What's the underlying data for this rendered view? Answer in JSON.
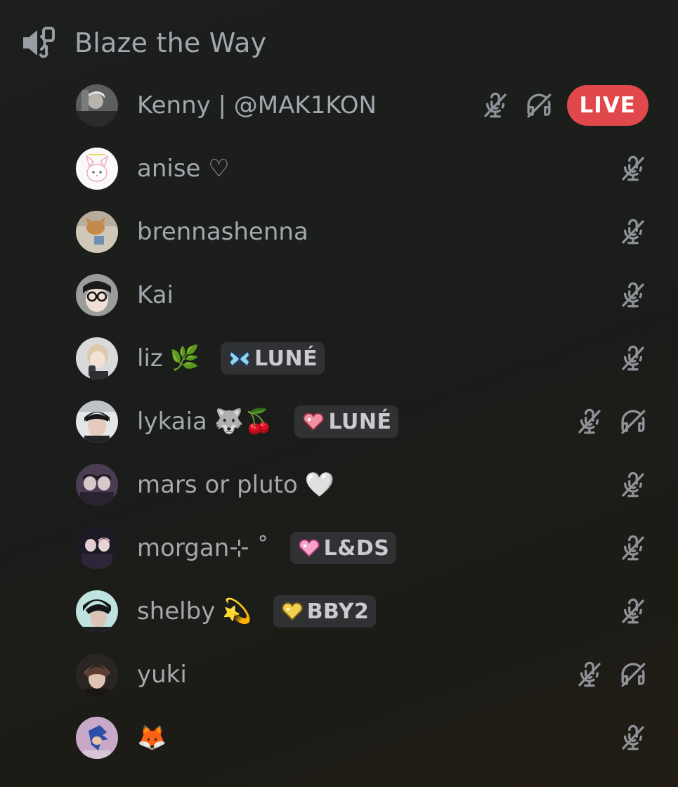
{
  "channel": {
    "name": "Blaze the Way",
    "icon": "voice-channel-speaker-icon"
  },
  "colors": {
    "background": "#1c1e1c",
    "text": "#a4a7ae",
    "icon": "#8f9298",
    "live_badge": "#e0484b",
    "tag_background": "#2f3133"
  },
  "members": [
    {
      "name": "Kenny | @MAK1KON",
      "emoji": "",
      "tag": null,
      "muted": true,
      "deafened": true,
      "live": "LIVE"
    },
    {
      "name": "anise ♡",
      "emoji": "",
      "tag": null,
      "muted": true,
      "deafened": false,
      "live": null
    },
    {
      "name": "brennashenna",
      "emoji": "",
      "tag": null,
      "muted": true,
      "deafened": false,
      "live": null
    },
    {
      "name": "Kai",
      "emoji": "",
      "tag": null,
      "muted": true,
      "deafened": false,
      "live": null
    },
    {
      "name": "liz",
      "emoji": "🌿",
      "tag": {
        "badge": "butterfly-icon",
        "label": "LUNÉ"
      },
      "muted": true,
      "deafened": false,
      "live": null
    },
    {
      "name": "lykaia",
      "emoji": "🐺🍒",
      "tag": {
        "badge": "heart-icon",
        "label": "LUNÉ"
      },
      "muted": true,
      "deafened": true,
      "live": null
    },
    {
      "name": "mars or pluto",
      "emoji": "🤍",
      "tag": null,
      "muted": true,
      "deafened": false,
      "live": null
    },
    {
      "name": "morgan⊹ ˚",
      "emoji": "",
      "tag": {
        "badge": "pink-heart-icon",
        "label": "L&DS"
      },
      "muted": true,
      "deafened": false,
      "live": null
    },
    {
      "name": "shelby",
      "emoji": "💫",
      "tag": {
        "badge": "gold-heart-icon",
        "label": "BBY2"
      },
      "muted": true,
      "deafened": false,
      "live": null
    },
    {
      "name": "yuki",
      "emoji": "",
      "tag": null,
      "muted": true,
      "deafened": true,
      "live": null
    },
    {
      "name": "",
      "emoji": "🦊",
      "tag": null,
      "muted": true,
      "deafened": false,
      "live": null
    }
  ]
}
